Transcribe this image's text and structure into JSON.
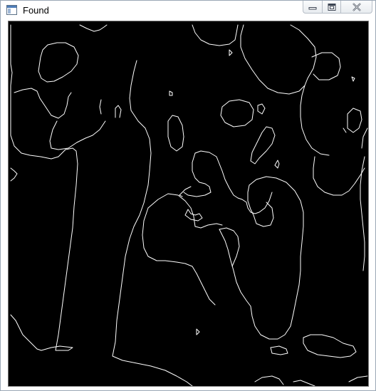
{
  "window": {
    "title": "Found",
    "icon": "window-app-icon",
    "buttons": [
      {
        "name": "minimize-button",
        "icon": "minimize-icon"
      },
      {
        "name": "maximize-button",
        "icon": "maximize-icon"
      },
      {
        "name": "close-button",
        "icon": "close-icon"
      }
    ]
  },
  "image": {
    "description_type": "binary edge map",
    "background_color": "#000000",
    "line_color": "#ffffff"
  }
}
